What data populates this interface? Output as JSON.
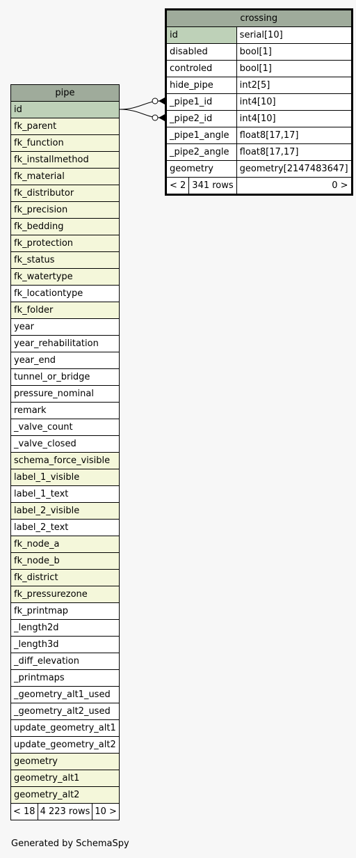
{
  "pipe": {
    "title": "pipe",
    "columns": [
      {
        "name": "id",
        "role": "pk"
      },
      {
        "name": "fk_parent",
        "role": "fk"
      },
      {
        "name": "fk_function",
        "role": "fk"
      },
      {
        "name": "fk_installmethod",
        "role": "fk"
      },
      {
        "name": "fk_material",
        "role": "fk"
      },
      {
        "name": "fk_distributor",
        "role": "fk"
      },
      {
        "name": "fk_precision",
        "role": "fk"
      },
      {
        "name": "fk_bedding",
        "role": "fk"
      },
      {
        "name": "fk_protection",
        "role": "fk"
      },
      {
        "name": "fk_status",
        "role": "fk"
      },
      {
        "name": "fk_watertype",
        "role": "fk"
      },
      {
        "name": "fk_locationtype",
        "role": "plain"
      },
      {
        "name": "fk_folder",
        "role": "fk"
      },
      {
        "name": "year",
        "role": "plain"
      },
      {
        "name": "year_rehabilitation",
        "role": "plain"
      },
      {
        "name": "year_end",
        "role": "plain"
      },
      {
        "name": "tunnel_or_bridge",
        "role": "plain"
      },
      {
        "name": "pressure_nominal",
        "role": "plain"
      },
      {
        "name": "remark",
        "role": "plain"
      },
      {
        "name": "_valve_count",
        "role": "plain"
      },
      {
        "name": "_valve_closed",
        "role": "plain"
      },
      {
        "name": "schema_force_visible",
        "role": "fk"
      },
      {
        "name": "label_1_visible",
        "role": "fk"
      },
      {
        "name": "label_1_text",
        "role": "plain"
      },
      {
        "name": "label_2_visible",
        "role": "fk"
      },
      {
        "name": "label_2_text",
        "role": "plain"
      },
      {
        "name": "fk_node_a",
        "role": "fk"
      },
      {
        "name": "fk_node_b",
        "role": "fk"
      },
      {
        "name": "fk_district",
        "role": "fk"
      },
      {
        "name": "fk_pressurezone",
        "role": "fk"
      },
      {
        "name": "fk_printmap",
        "role": "plain"
      },
      {
        "name": "_length2d",
        "role": "plain"
      },
      {
        "name": "_length3d",
        "role": "plain"
      },
      {
        "name": "_diff_elevation",
        "role": "plain"
      },
      {
        "name": "_printmaps",
        "role": "plain"
      },
      {
        "name": "_geometry_alt1_used",
        "role": "plain"
      },
      {
        "name": "_geometry_alt2_used",
        "role": "plain"
      },
      {
        "name": "update_geometry_alt1",
        "role": "plain"
      },
      {
        "name": "update_geometry_alt2",
        "role": "plain"
      },
      {
        "name": "geometry",
        "role": "fk"
      },
      {
        "name": "geometry_alt1",
        "role": "fk"
      },
      {
        "name": "geometry_alt2",
        "role": "fk"
      }
    ],
    "footer": {
      "parents": "< 18",
      "rows": "4 223 rows",
      "children": "10 >"
    }
  },
  "crossing": {
    "title": "crossing",
    "columns": [
      {
        "name": "id",
        "type": "serial[10]",
        "role": "pk"
      },
      {
        "name": "disabled",
        "type": "bool[1]",
        "role": "plain"
      },
      {
        "name": "controled",
        "type": "bool[1]",
        "role": "plain"
      },
      {
        "name": "hide_pipe",
        "type": "int2[5]",
        "role": "plain"
      },
      {
        "name": "_pipe1_id",
        "type": "int4[10]",
        "role": "plain"
      },
      {
        "name": "_pipe2_id",
        "type": "int4[10]",
        "role": "plain"
      },
      {
        "name": "_pipe1_angle",
        "type": "float8[17,17]",
        "role": "plain"
      },
      {
        "name": "_pipe2_angle",
        "type": "float8[17,17]",
        "role": "plain"
      },
      {
        "name": "geometry",
        "type": "geometry[2147483647]",
        "role": "plain"
      }
    ],
    "footer": {
      "parents": "< 2",
      "rows": "341 rows",
      "children": "0 >"
    }
  },
  "footer": {
    "generated_by": "Generated by SchemaSpy"
  }
}
